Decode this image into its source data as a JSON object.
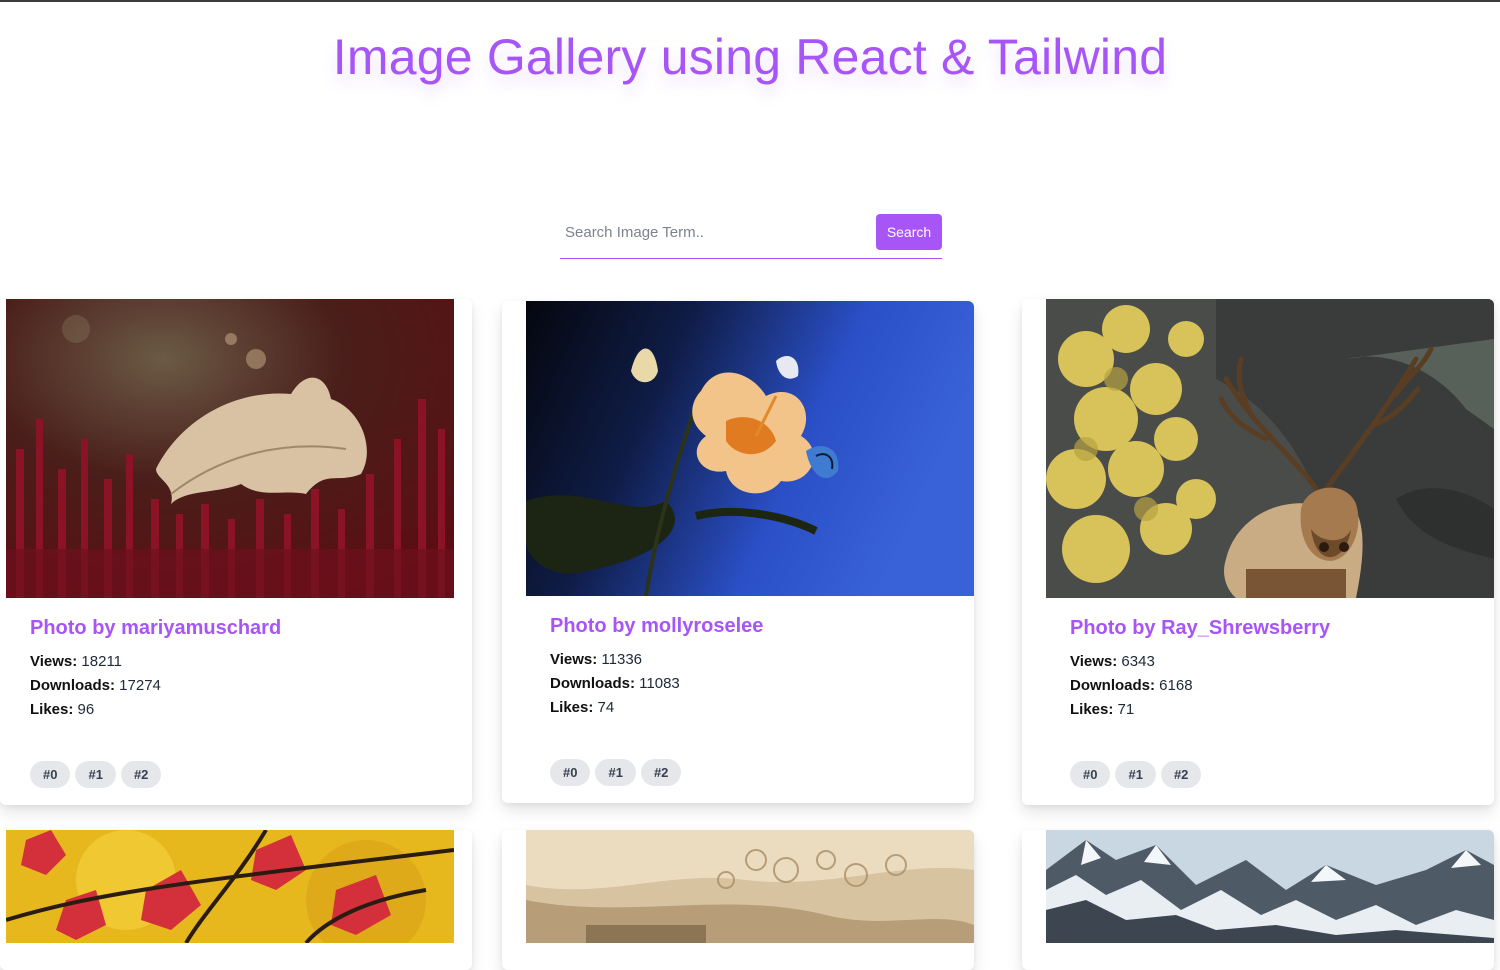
{
  "header": {
    "title": "Image Gallery using React & Tailwind"
  },
  "search": {
    "placeholder": "Search Image Term..",
    "value": "",
    "button_label": "Search"
  },
  "labels": {
    "views": "Views:",
    "downloads": "Downloads:",
    "likes": "Likes:"
  },
  "cards": [
    {
      "author": "Photo by mariyamuschard",
      "views": "18211",
      "downloads": "17274",
      "likes": "96",
      "tags": [
        "#0",
        "#1",
        "#2"
      ]
    },
    {
      "author": "Photo by mollyroselee",
      "views": "11336",
      "downloads": "11083",
      "likes": "74",
      "tags": [
        "#0",
        "#1",
        "#2"
      ]
    },
    {
      "author": "Photo by Ray_Shrewsberry",
      "views": "6343",
      "downloads": "6168",
      "likes": "71",
      "tags": [
        "#0",
        "#1",
        "#2"
      ]
    }
  ],
  "colors": {
    "accent": "#a855f7",
    "tag_bg": "#e5e7eb"
  }
}
